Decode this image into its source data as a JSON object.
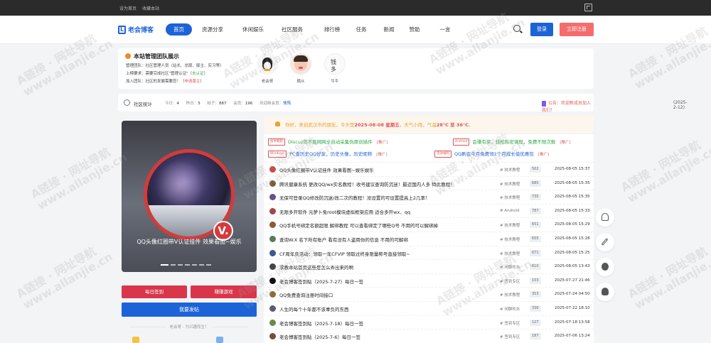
{
  "topbar": {
    "home_link": "设为首页",
    "favorite_link": "收藏本站"
  },
  "logo": {
    "mark": "L",
    "text": "老会博客"
  },
  "nav": {
    "items": [
      {
        "label": "首页",
        "active": true
      },
      {
        "label": "资源分享",
        "active": false
      },
      {
        "label": "休闲娱乐",
        "active": false
      },
      {
        "label": "社区服务",
        "active": false
      },
      {
        "label": "排行榜",
        "active": false
      },
      {
        "label": "任务",
        "active": false
      },
      {
        "label": "新闻",
        "active": false
      },
      {
        "label": "赞助",
        "active": false
      },
      {
        "label": "一言",
        "active": false
      }
    ],
    "login": "登录",
    "register": "立即注册"
  },
  "team": {
    "title": "本站管理团队展示",
    "line1": "管理团队：社区管理人员（站长、总版、版主、实习等）",
    "line2_a": "上榜要求：需要完成社区\"管理认证\"（",
    "line2_b": "去认证",
    "line2_c": "）",
    "line3_a": "加入团队：社区的发展需要您！（",
    "line3_b": "申请版主",
    "line3_c": "）",
    "members": [
      {
        "name": "老会哥"
      },
      {
        "name": "顺从"
      },
      {
        "name": "牛牛"
      }
    ]
  },
  "stats": {
    "label": "社区统计",
    "today_label": "今日：",
    "today": "4",
    "yesterday_label": "昨日：",
    "yesterday": "5",
    "threads_label": "帖子：",
    "threads": "887",
    "members_label": "会员：",
    "members": "196",
    "welcome_label": "欢迎新会员：",
    "welcome": "情殇",
    "notice_a": "公告：",
    "notice_b": "欢迎新成员加入我们！",
    "date": "(2025-2-12)"
  },
  "slider": {
    "v": "V.",
    "caption": "QQ头像红圈带V认证挂件 效果看图~娱乐"
  },
  "buttons": {
    "sign": "每日签到",
    "game": "赚赚游戏",
    "post": "我要发帖"
  },
  "slogan": "老会哥 - 为兴趣而生！",
  "weather": {
    "prefix": "你好，来自武汉市的朋友，今天是",
    "date": "2025-08-08 星期五",
    "mid": "，天气小雨，气温",
    "temp": "28°C 至 36°C",
    "suffix": "。"
  },
  "promos": [
    {
      "tag": "技术教程",
      "text": "Discuz防不胜网网全自动采集伪原创插件",
      "mark": "[推广]",
      "color": "#2ea64a"
    },
    {
      "tag": "Android",
      "text": "会赚有奖，轻松私密课程，免费不限次数",
      "mark": "[推广]",
      "color": "#2ea64a"
    },
    {
      "tag": "Windows",
      "text": "PC查历史QQ好友，历史头像，历史昵称",
      "mark": "[推广]",
      "color": "#1d63d8"
    },
    {
      "tag": "活动福利",
      "text": "QQ刷会今月免费领1个月成长值优惠包",
      "mark": "[推广]",
      "color": "#1d63d8"
    }
  ],
  "threads": [
    {
      "title": "QQ头像红圈带V认证挂件 效果看图~娱乐娱乐",
      "forum": "技术教程",
      "count": "502",
      "time": "2025-08-05 15:37",
      "icon": "#c94b4b"
    },
    {
      "title": "腾讯健康系统 更改QQ/wx实名教程！收号建议查询防沉迷！最近国内人多 特此教程！",
      "forum": "技术教程",
      "count": "685",
      "time": "2025-08-05 15:35",
      "icon": "#7d5a3a"
    },
    {
      "title": "无保可登录QQ修改防沉迷/改二次的教程！没设置的可设置提高上2几率！",
      "forum": "技术教程",
      "count": "735",
      "time": "2025-08-05 15:35",
      "icon": "#6b4e8c"
    },
    {
      "title": "无限多开软件 元萝卜免root模块虚拟框架应用 适合多开wx、qq",
      "forum": "Android",
      "count": "787",
      "time": "2025-08-05 15:33",
      "icon": "#a04848"
    },
    {
      "title": "QQ手机号绑定名额超限 解绑教程 可以查看绑定了哪些Q号 不用的可以解绑掉",
      "forum": "技术教程",
      "count": "651",
      "time": "2025-08-05 15:29",
      "icon": "#8c5a3c"
    },
    {
      "title": "查询W.X 名下所有账户 看有没有人盗用你的信息 不用的可解绑",
      "forum": "技术教程",
      "count": "655",
      "time": "2025-08-05 15:28",
      "icon": "#5a7a5a"
    },
    {
      "title": "CF周年庆活动：领取一年CFVIP 领取过终身限量称号直接领取~",
      "forum": "技术教程",
      "count": "671",
      "time": "2025-08-05 15:25",
      "icon": "#3a5a8c"
    },
    {
      "title": "求教本站首页这些是怎么弄出来的啊",
      "forum": "闲聊吹水",
      "count": "610",
      "time": "2025-08-05 13:43",
      "icon": "#444444"
    },
    {
      "title": "老会博客签到贴（2025-7-27）每日一签",
      "forum": "签到专区",
      "count": "103",
      "time": "2025-07-27 21:46",
      "icon": "#111111"
    },
    {
      "title": "QQ免费查询注册时间接口",
      "forum": "技术教程",
      "count": "353",
      "time": "2025-07-24 04:50",
      "icon": "#8c6a3a"
    },
    {
      "title": "人生的每个十年都不该辜负的东西",
      "forum": "闲聊吹水",
      "count": "336",
      "time": "2025-07-22 18:10",
      "icon": "#5a5a7a"
    },
    {
      "title": "老会博客签到贴（2025-7-18）每日一签",
      "forum": "签到专区",
      "count": "127",
      "time": "2025-07-18 13:58",
      "icon": "#6a8a4a"
    },
    {
      "title": "老会博客签到贴（2025-7-6）每日一签",
      "forum": "签到专区",
      "count": "187",
      "time": "2025-07-06 13:24",
      "icon": "#7a4a3a"
    }
  ],
  "watermark": {
    "line1": "A链接 · 网址导航",
    "line2": "www.allanjie.cn"
  },
  "colors": {
    "primary": "#1d63d8",
    "danger": "#d9364b",
    "register": "#f56c6c",
    "notice_bg": "#fdf6ec"
  }
}
